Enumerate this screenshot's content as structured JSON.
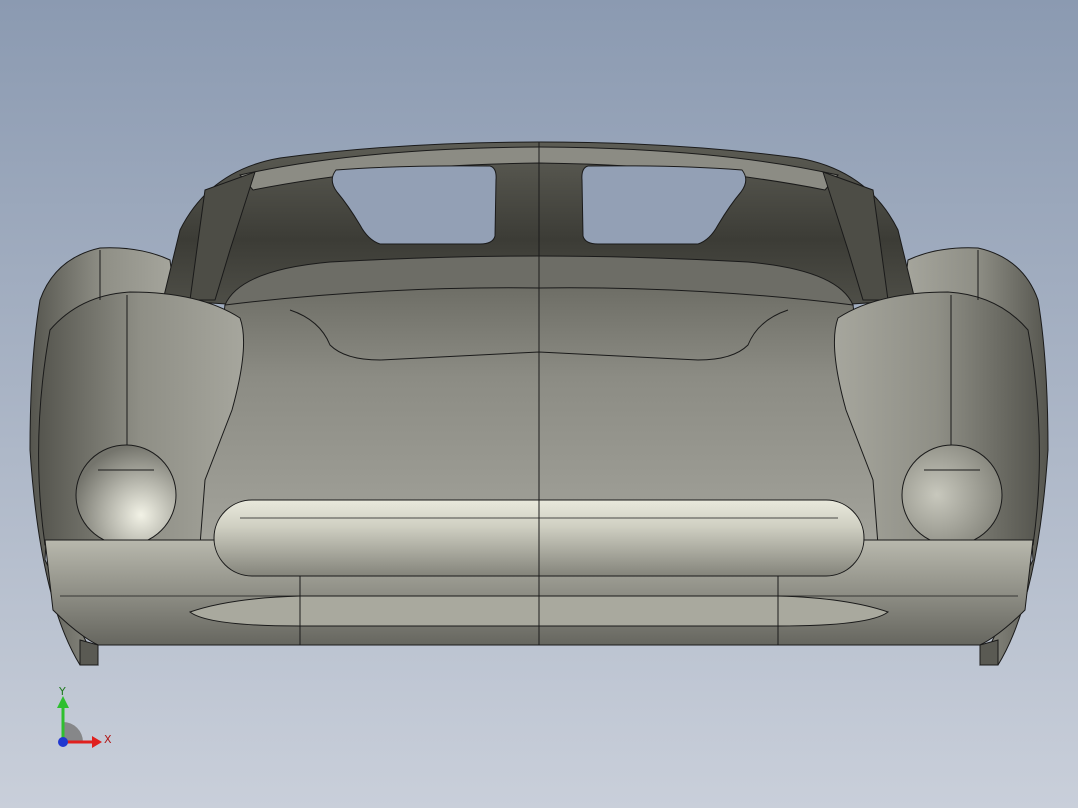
{
  "viewport": {
    "background_top": "#8b9ab1",
    "background_bottom": "#c9cfda"
  },
  "model": {
    "view": "front",
    "body_color": "#8f8f85",
    "edge_color": "#1a1a1a"
  },
  "triad": {
    "x_label": "X",
    "y_label": "Y",
    "x_color": "#e0201e",
    "y_color": "#2fbf2f",
    "z_color": "#2038d0"
  }
}
